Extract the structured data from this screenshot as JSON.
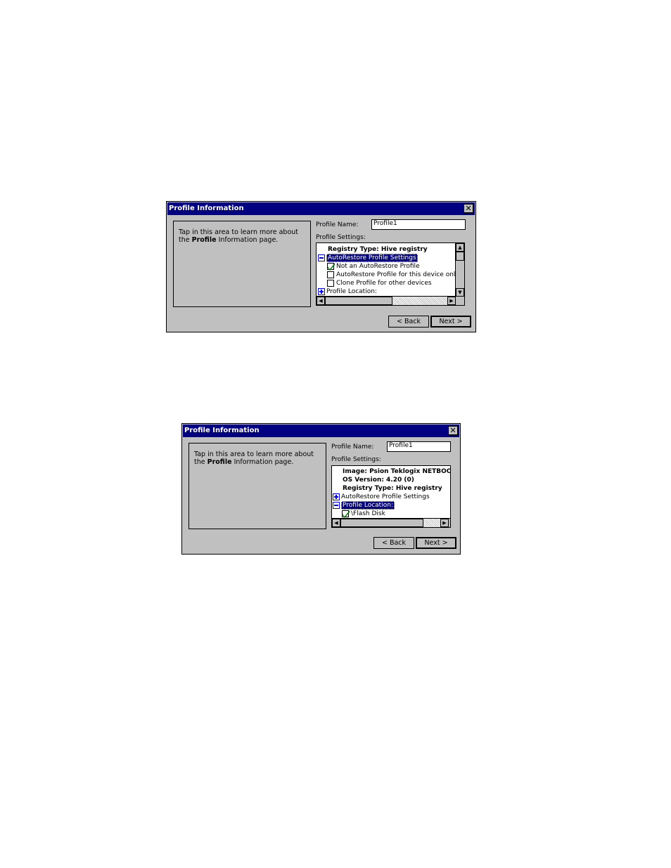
{
  "dialogs": [
    {
      "title": "Profile Information",
      "close_glyph": "✕",
      "help_text_1": "Tap in this area to learn more about the ",
      "help_text_bold": "Profile",
      "help_text_2": " Information page.",
      "profile_name_label": "Profile Name:",
      "profile_name_value": "Profile1",
      "profile_settings_label": "Profile Settings:",
      "tree": {
        "r1": "Registry Type:   Hive registry",
        "r2": "AutoRestore Profile Settings",
        "r3": "Not an AutoRestore Profile",
        "r4": "AutoRestore Profile for this device only",
        "r5": "Clone Profile for other devices",
        "r6": "Profile Location:"
      },
      "back_label": "< Back",
      "next_label": "Next >"
    },
    {
      "title": "Profile Information",
      "close_glyph": "✕",
      "help_text_1": "Tap in this area to learn more about the ",
      "help_text_bold": "Profile",
      "help_text_2": " Information page.",
      "profile_name_label": "Profile Name:",
      "profile_name_value": "Profile1",
      "profile_settings_label": "Profile Settings:",
      "tree": {
        "r1": "Image:  Psion Teklogix NETBOO",
        "r2": "OS Version:    4.20 (0)",
        "r3": "Registry Type:   Hive registry",
        "r4": "AutoRestore Profile Settings",
        "r5": "Profile Location:",
        "r6": "\\Flash Disk"
      },
      "back_label": "< Back",
      "next_label": "Next >"
    }
  ]
}
